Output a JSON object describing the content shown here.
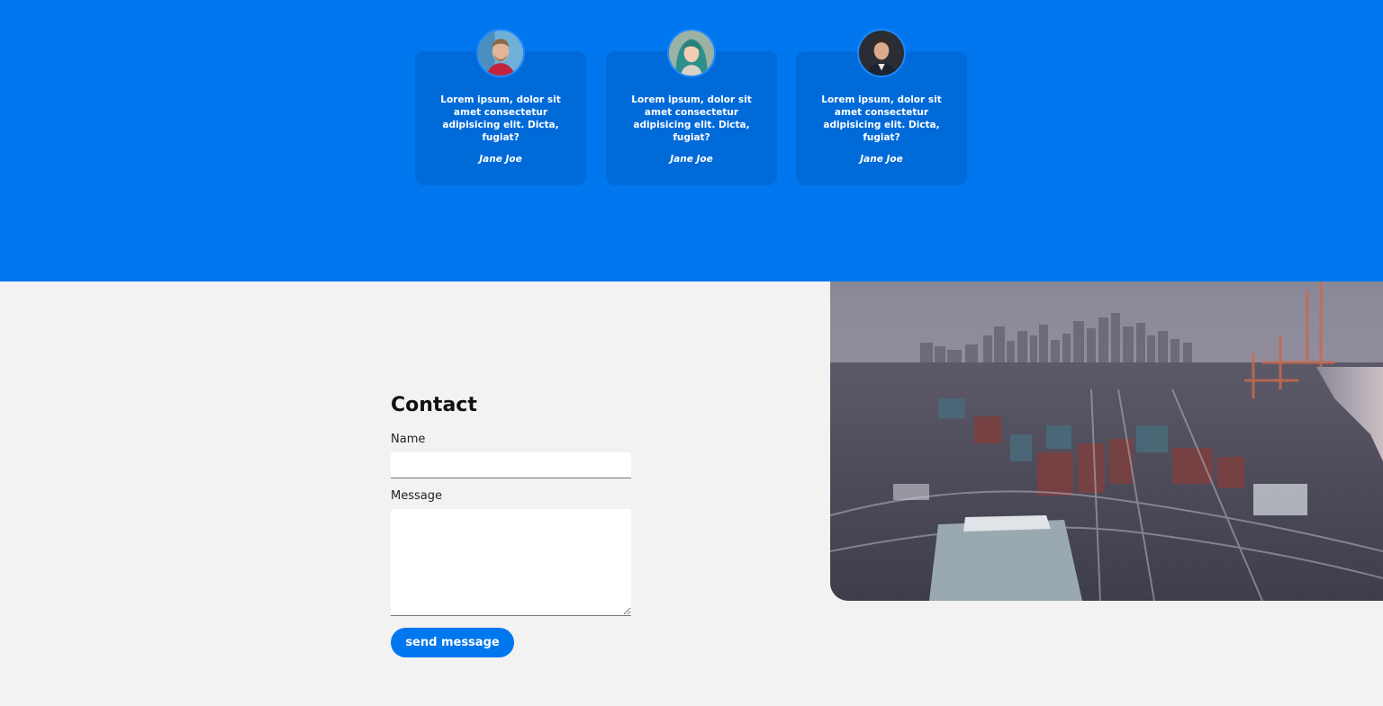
{
  "testimonials": [
    {
      "quote": "Lorem ipsum, dolor sit amet consectetur adipisicing elit. Dicta, fugiat?",
      "author": "Jane Joe"
    },
    {
      "quote": "Lorem ipsum, dolor sit amet consectetur adipisicing elit. Dicta, fugiat?",
      "author": "Jane Joe"
    },
    {
      "quote": "Lorem ipsum, dolor sit amet consectetur adipisicing elit. Dicta, fugiat?",
      "author": "Jane Joe"
    }
  ],
  "contact": {
    "title": "Contact",
    "name_label": "Name",
    "name_value": "",
    "message_label": "Message",
    "message_value": "",
    "send_label": "send message"
  },
  "colors": {
    "brand_blue": "#0077ee",
    "card_blue": "#006ad9",
    "page_bg": "#f2f2f2"
  },
  "images": {
    "avatars": [
      "avatar-man-smiling",
      "avatar-woman-teal-hair",
      "avatar-man-suit"
    ],
    "hero": "city-port-aerial-photo"
  }
}
